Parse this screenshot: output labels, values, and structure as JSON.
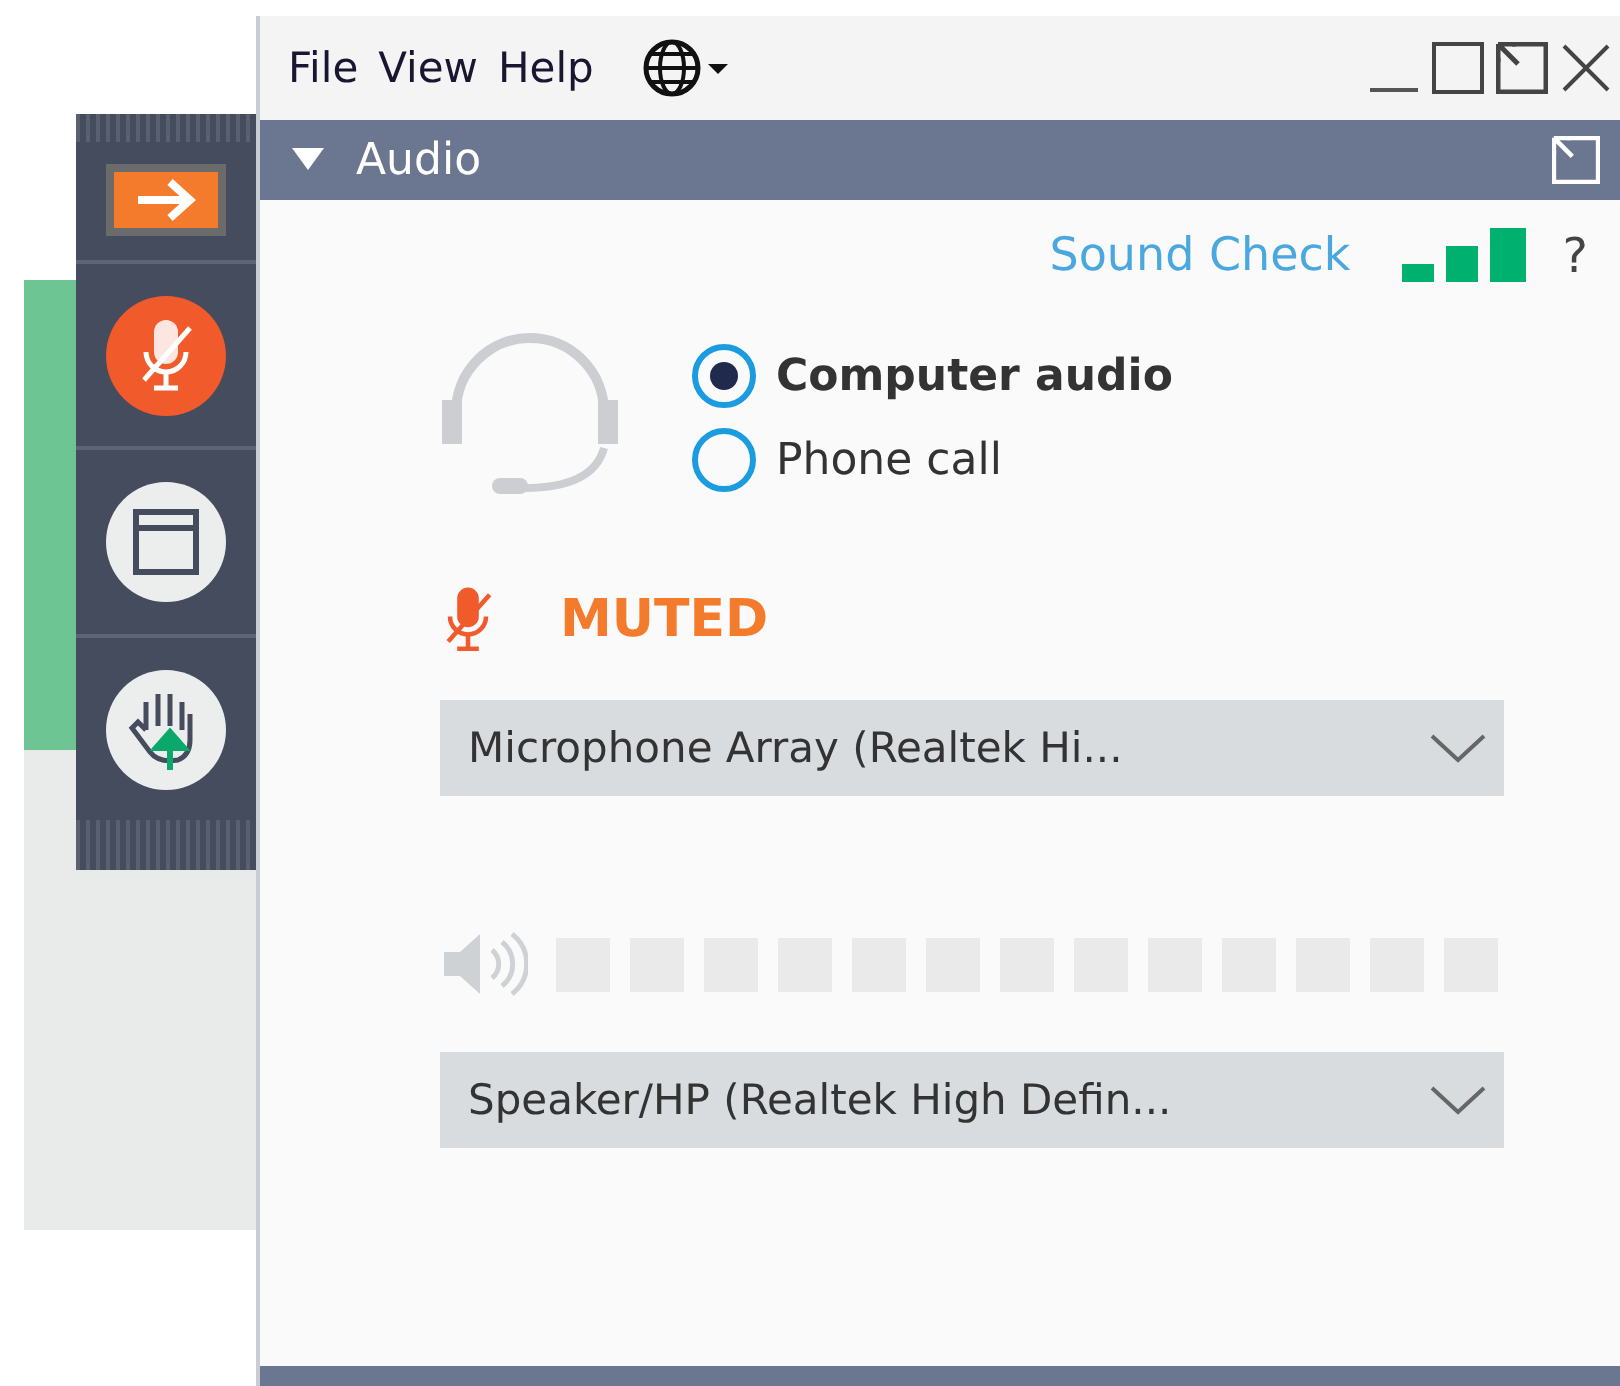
{
  "menu": [
    {
      "label": "File"
    },
    {
      "label": "View"
    },
    {
      "label": "Help"
    }
  ],
  "panel": {
    "title": "Audio",
    "expanded": true
  },
  "sound_check": {
    "label": "Sound Check",
    "help": "?"
  },
  "audio_options": [
    {
      "label": "Computer audio",
      "selected": true
    },
    {
      "label": "Phone call",
      "selected": false
    }
  ],
  "microphone": {
    "status": "MUTED",
    "device": "Microphone Array (Realtek Hi..."
  },
  "speaker": {
    "level": 0,
    "device": "Speaker/HP (Realtek High Defin..."
  }
}
